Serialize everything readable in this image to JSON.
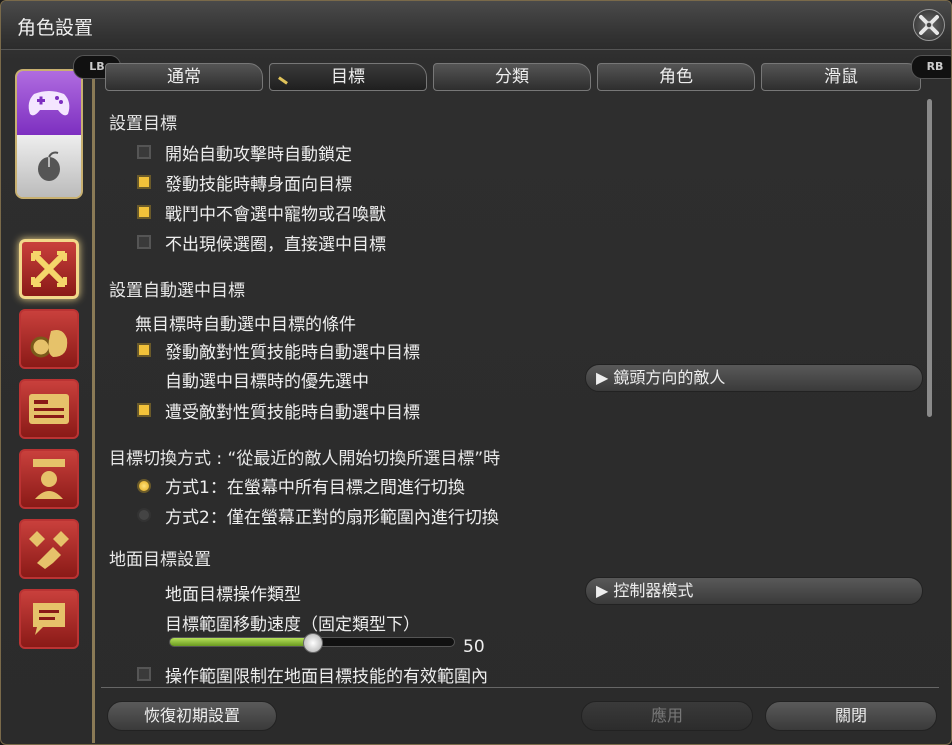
{
  "window": {
    "title": "角色設置"
  },
  "sidebar": {
    "mode_switch": [
      "gamepad-icon",
      "mouse-icon"
    ],
    "categories": [
      "target-icon",
      "gear-bag-icon",
      "id-card-icon",
      "character-icon",
      "checkered-icon",
      "chat-icon"
    ]
  },
  "tabs": {
    "lb": "LB",
    "rb": "RB",
    "items": [
      {
        "label": "通常"
      },
      {
        "label": "目標",
        "active": true
      },
      {
        "label": "分類"
      },
      {
        "label": "角色"
      },
      {
        "label": "滑鼠"
      }
    ]
  },
  "sections": {
    "target": {
      "title": "設置目標",
      "options": [
        {
          "label": "開始自動攻擊時自動鎖定",
          "checked": false
        },
        {
          "label": "發動技能時轉身面向目標",
          "checked": true
        },
        {
          "label": "戰鬥中不會選中寵物或召喚獸",
          "checked": true
        },
        {
          "label": "不出現候選圈，直接選中目標",
          "checked": false
        }
      ]
    },
    "auto_target": {
      "title": "設置自動選中目標",
      "subtitle": "無目標時自動選中目標的條件",
      "opt1": {
        "label": "發動敵對性質技能時自動選中目標",
        "checked": true
      },
      "priority_label": "自動選中目標時的優先選中",
      "priority_value": "鏡頭方向的敵人",
      "opt2": {
        "label": "遭受敵對性質技能時自動選中目標",
        "checked": true
      }
    },
    "switch": {
      "title": "目標切換方式 : “從最近的敵人開始切換所選目標”時",
      "radio1": {
        "label": "方式1：在螢幕中所有目標之間進行切換",
        "selected": true
      },
      "radio2": {
        "label": "方式2：僅在螢幕正對的扇形範圍內進行切換",
        "selected": false
      }
    },
    "ground": {
      "title": "地面目標設置",
      "type_label": "地面目標操作類型",
      "type_value": "控制器模式",
      "speed_label": "目標範圍移動速度（固定類型下）",
      "speed_value": "50",
      "speed_fraction": 0.5,
      "limit_label": "操作範圍限制在地面目標技能的有效範圍內",
      "limit_checked": false
    }
  },
  "footer": {
    "reset": "恢復初期設置",
    "apply": "應用",
    "close": "關閉"
  }
}
